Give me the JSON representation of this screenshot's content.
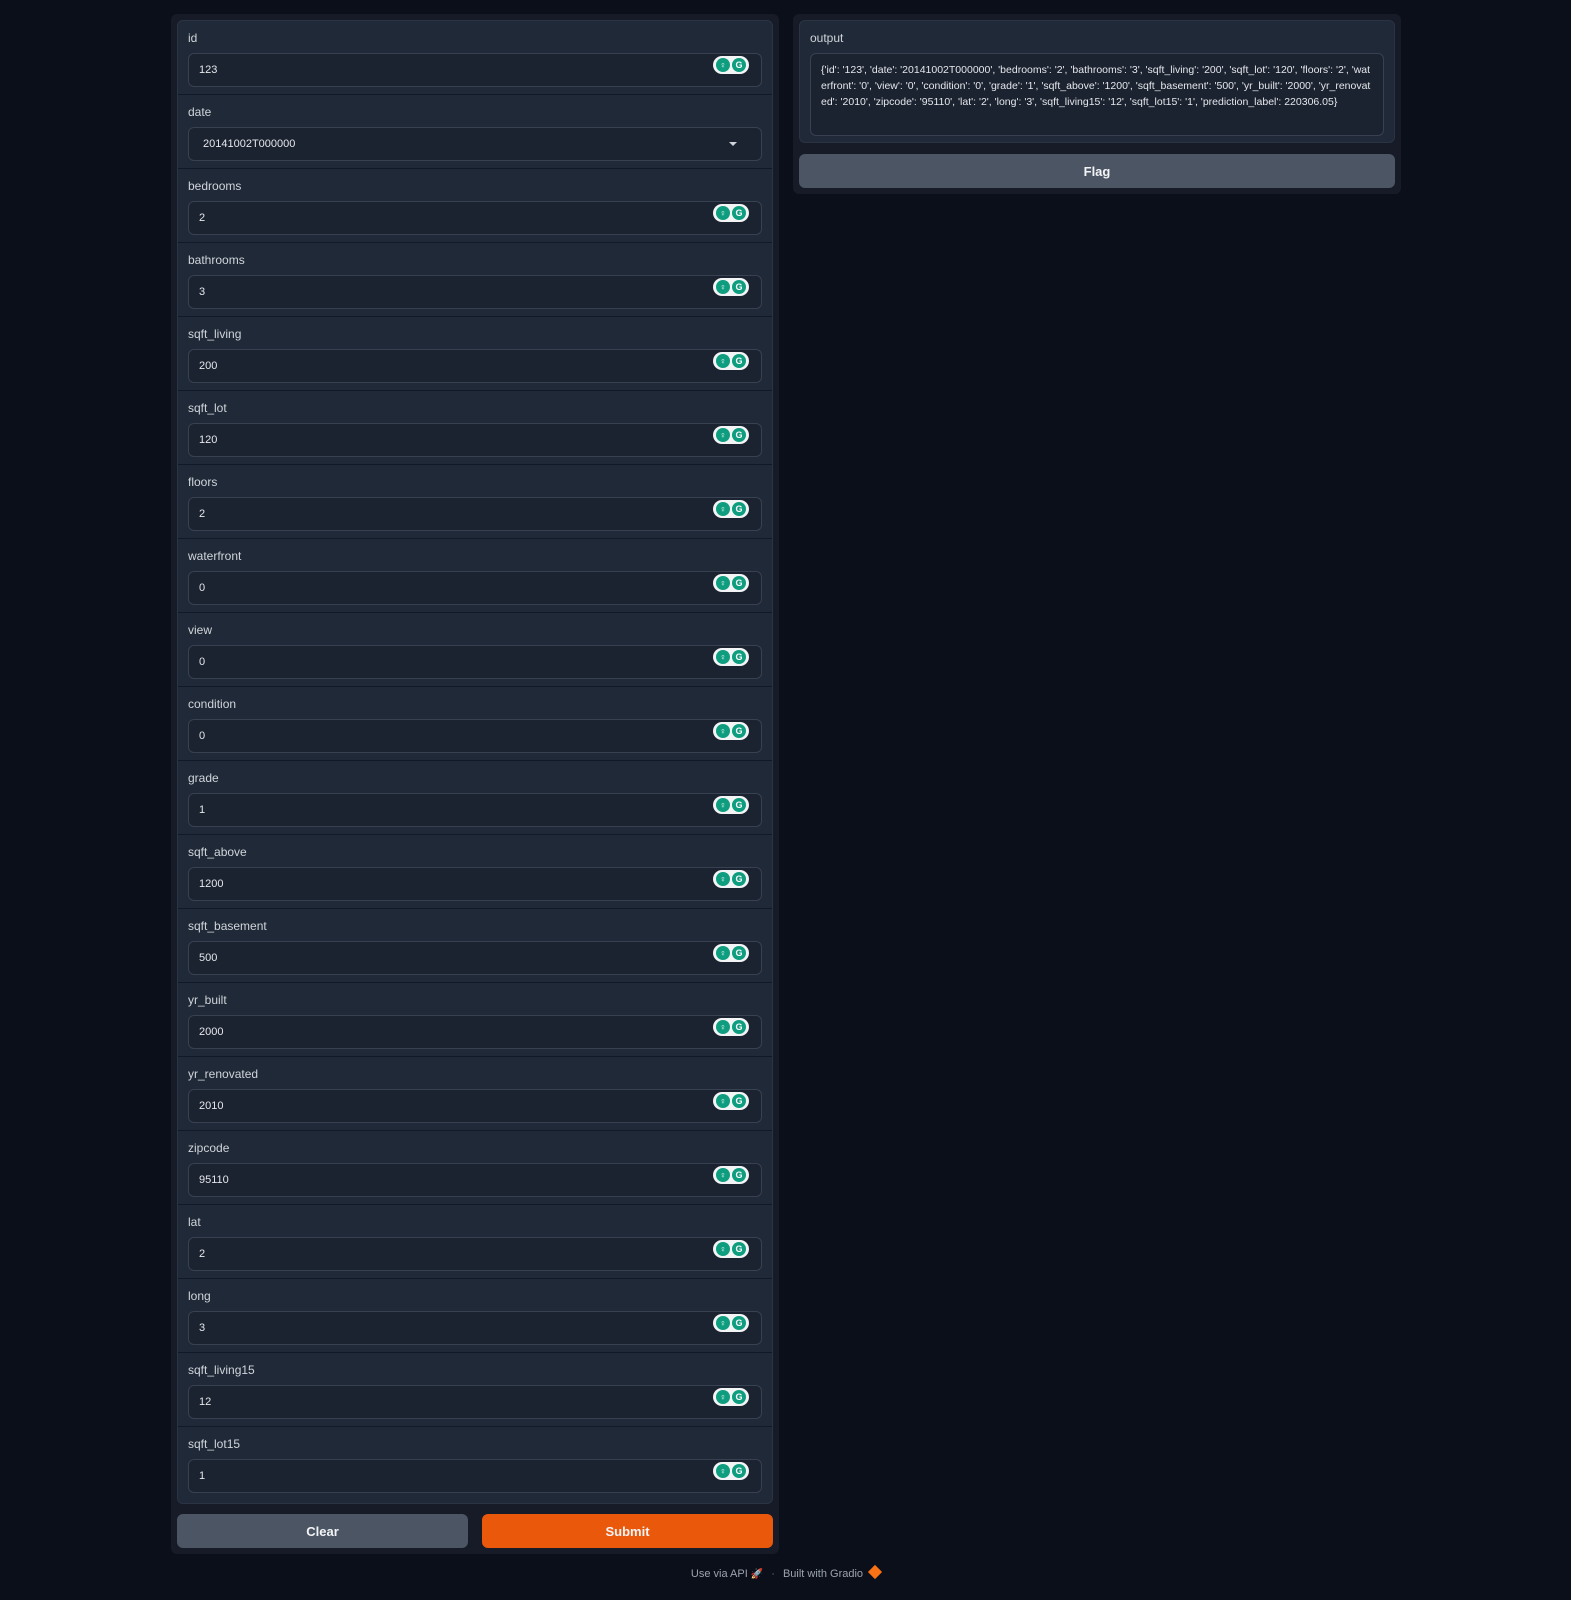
{
  "form": {
    "fields": [
      {
        "label": "id",
        "value": "123"
      },
      {
        "label": "date",
        "value": "20141002T000000",
        "type": "dropdown"
      },
      {
        "label": "bedrooms",
        "value": "2"
      },
      {
        "label": "bathrooms",
        "value": "3"
      },
      {
        "label": "sqft_living",
        "value": "200"
      },
      {
        "label": "sqft_lot",
        "value": "120"
      },
      {
        "label": "floors",
        "value": "2"
      },
      {
        "label": "waterfront",
        "value": "0"
      },
      {
        "label": "view",
        "value": "0"
      },
      {
        "label": "condition",
        "value": "0"
      },
      {
        "label": "grade",
        "value": "1"
      },
      {
        "label": "sqft_above",
        "value": "1200"
      },
      {
        "label": "sqft_basement",
        "value": "500"
      },
      {
        "label": "yr_built",
        "value": "2000"
      },
      {
        "label": "yr_renovated",
        "value": "2010"
      },
      {
        "label": "zipcode",
        "value": "95110"
      },
      {
        "label": "lat",
        "value": "2"
      },
      {
        "label": "long",
        "value": "3"
      },
      {
        "label": "sqft_living15",
        "value": "12"
      },
      {
        "label": "sqft_lot15",
        "value": "1"
      }
    ],
    "clear_label": "Clear",
    "submit_label": "Submit"
  },
  "output": {
    "label": "output",
    "text": "{'id': '123', 'date': '20141002T000000', 'bedrooms': '2', 'bathrooms': '3', 'sqft_living': '200', 'sqft_lot': '120', 'floors': '2', 'waterfront': '0', 'view': '0', 'condition': '0', 'grade': '1', 'sqft_above': '1200', 'sqft_basement': '500', 'yr_built': '2000', 'yr_renovated': '2010', 'zipcode': '95110', 'lat': '2', 'long': '3', 'sqft_living15': '12', 'sqft_lot15': '1', 'prediction_label': 220306.05}",
    "flag_label": "Flag"
  },
  "footer": {
    "api_label": "Use via API",
    "separator": "·",
    "built_label": "Built with Gradio"
  },
  "colors": {
    "background": "#0b0f19",
    "panel": "#1f2937",
    "submit": "#ea580c",
    "secondary_button": "#4b5563",
    "grammarly": "#0f9d7f"
  },
  "icons": {
    "grammarly": "grammarly-icon",
    "dropdown": "chevron-down-icon",
    "api": "rocket-icon",
    "gradio": "gradio-logo-icon"
  }
}
